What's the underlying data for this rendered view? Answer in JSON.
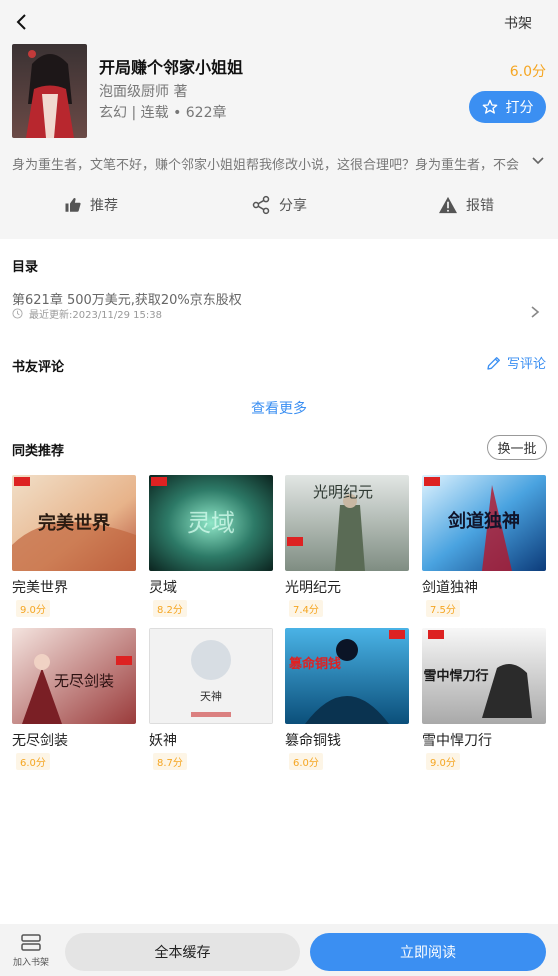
{
  "header": {
    "shelf_label": "书架"
  },
  "book": {
    "title": "开局赚个邻家小姐姐",
    "author": "泡面级厨师 著",
    "meta": "玄幻 | 连载 • 622章",
    "score": "6.0分",
    "rate_label": "打分",
    "intro": "身为重生者，文笔不好，赚个邻家小姐姐帮我修改小说，这很合理吧？身为重生者，不会"
  },
  "actions": [
    {
      "label": "推荐",
      "icon": "thumb-up-icon"
    },
    {
      "label": "分享",
      "icon": "share-icon"
    },
    {
      "label": "报错",
      "icon": "warning-icon"
    }
  ],
  "toc": {
    "title": "目录",
    "latest_chapter": "第621章 500万美元,获取20%京东股权",
    "updated": "最近更新:2023/11/29 15:38"
  },
  "reviews": {
    "title": "书友评论",
    "write_label": "写评论",
    "see_more": "查看更多"
  },
  "recommend": {
    "title": "同类推荐",
    "refresh_label": "换一批",
    "items": [
      {
        "name": "完美世界",
        "score": "9.0分",
        "cover_text": "完美世界"
      },
      {
        "name": "灵域",
        "score": "8.2分",
        "cover_text": "灵域"
      },
      {
        "name": "光明纪元",
        "score": "7.4分",
        "cover_text": "光明纪元"
      },
      {
        "name": "剑道独神",
        "score": "7.5分",
        "cover_text": "剑道独神"
      },
      {
        "name": "无尽剑装",
        "score": "6.0分",
        "cover_text": "无尽剑装"
      },
      {
        "name": "妖神",
        "score": "8.7分",
        "cover_text": "天神"
      },
      {
        "name": "篡命铜钱",
        "score": "6.0分",
        "cover_text": "篡命铜钱"
      },
      {
        "name": "雪中悍刀行",
        "score": "9.0分",
        "cover_text": "雪中悍刀行"
      }
    ]
  },
  "bottom": {
    "add_shelf_label": "加入书架",
    "cache_label": "全本缓存",
    "read_label": "立即阅读"
  },
  "colors": {
    "accent": "#3b8ff2",
    "score": "#f5a623",
    "background": "#f5f5f5"
  }
}
